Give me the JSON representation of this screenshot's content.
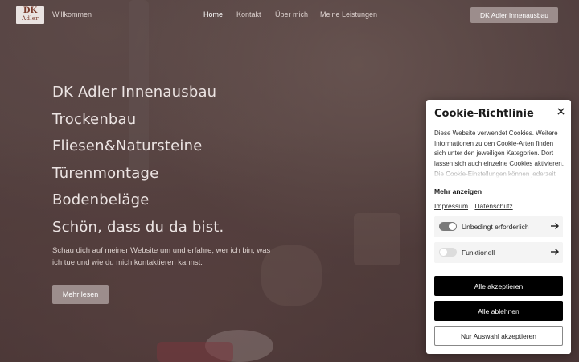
{
  "header": {
    "logo_top": "DK",
    "logo_bottom": "Adler",
    "welcome": "Willkommen",
    "nav": [
      {
        "label": "Home",
        "active": true
      },
      {
        "label": "Kontakt",
        "active": false
      },
      {
        "label": "Über mich",
        "active": false
      },
      {
        "label": "Meine Leistungen",
        "active": false
      }
    ],
    "cta_label": "DK Adler Innenausbau"
  },
  "hero": {
    "lines": [
      "DK Adler  Innenausbau",
      "Trockenbau",
      "Fliesen&Natursteine",
      "Türenmontage",
      "Bodenbeläge",
      "Schön, dass du da bist."
    ],
    "description": "Schau dich auf meiner Website um und erfahre, wer ich bin, was ich tue und wie du mich kontaktieren kannst.",
    "button_label": "Mehr lesen"
  },
  "cookie": {
    "title": "Cookie-Richtlinie",
    "close_icon": "close-icon",
    "text": "Diese Website verwendet Cookies. Weitere Informationen zu den Cookie-Arten finden sich unter den jeweiligen Kategorien. Dort lassen sich auch einzelne Cookies aktivieren. Die Cookie-Einstellungen können jederzeit",
    "show_more": "Mehr anzeigen",
    "links": [
      "Impressum",
      "Datenschutz"
    ],
    "categories": [
      {
        "label": "Unbedingt erforderlich",
        "enabled": true
      },
      {
        "label": "Funktionell",
        "enabled": false
      }
    ],
    "accept_all": "Alle akzeptieren",
    "reject_all": "Alle ablehnen",
    "accept_selection": "Nur Auswahl akzeptieren"
  },
  "colors": {
    "button_muted": "#9c8d8c",
    "cookie_primary": "#000000",
    "toggle_on": "#7a7a7a",
    "toggle_off": "#dcdcdc"
  }
}
